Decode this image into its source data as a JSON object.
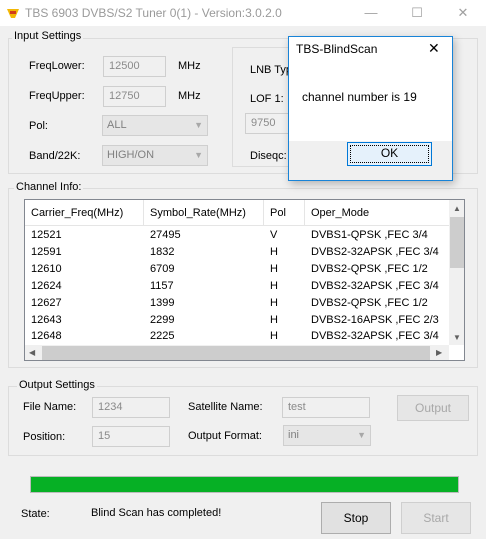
{
  "window": {
    "title": "TBS 6903 DVBS/S2 Tuner 0(1) - Version:3.0.2.0",
    "icon_name": "tbs-app-icon",
    "controls": {
      "minimize": "—",
      "maximize": "☐",
      "close": "✕"
    }
  },
  "input_settings": {
    "group_label": "Input Settings",
    "freq_lower": {
      "label": "FreqLower:",
      "value": "12500",
      "unit": "MHz"
    },
    "freq_upper": {
      "label": "FreqUpper:",
      "value": "12750",
      "unit": "MHz"
    },
    "pol": {
      "label": "Pol:",
      "value": "ALL"
    },
    "band": {
      "label": "Band/22K:",
      "value": "HIGH/ON"
    },
    "lnb_type": {
      "label": "LNB Typ"
    },
    "lof1": {
      "label": "LOF 1:",
      "value": "9750"
    },
    "diseqc": {
      "label": "Diseqc:"
    }
  },
  "channel_info": {
    "group_label": "Channel Info:",
    "columns": [
      "Carrier_Freq(MHz)",
      "Symbol_Rate(MHz)",
      "Pol",
      "Oper_Mode"
    ],
    "rows": [
      [
        "12521",
        "27495",
        "V",
        "DVBS1-QPSK ,FEC 3/4"
      ],
      [
        "12591",
        "1832",
        "H",
        "DVBS2-32APSK ,FEC 3/4"
      ],
      [
        "12610",
        "6709",
        "H",
        "DVBS2-QPSK ,FEC 1/2"
      ],
      [
        "12624",
        "1157",
        "H",
        "DVBS2-32APSK ,FEC 3/4"
      ],
      [
        "12627",
        "1399",
        "H",
        "DVBS2-QPSK ,FEC 1/2"
      ],
      [
        "12643",
        "2299",
        "H",
        "DVBS2-16APSK ,FEC 2/3"
      ],
      [
        "12648",
        "2225",
        "H",
        "DVBS2-32APSK ,FEC 3/4"
      ]
    ]
  },
  "output_settings": {
    "group_label": "Output Settings",
    "file_name": {
      "label": "File Name:",
      "value": "1234"
    },
    "satellite_name": {
      "label": "Satellite Name:",
      "value": "test"
    },
    "position": {
      "label": "Position:",
      "value": "15"
    },
    "output_format": {
      "label": "Output Format:",
      "value": "ini"
    },
    "output_button": "Output"
  },
  "progress": {
    "fraction": 1.0,
    "color": "#06b025"
  },
  "status": {
    "label": "State:",
    "text": "Blind Scan has completed!",
    "stop_button": "Stop",
    "start_button": "Start"
  },
  "dialog": {
    "title": "TBS-BlindScan",
    "message": "channel number is 19",
    "ok_button": "OK",
    "close": "✕",
    "border_color": "#1883d7"
  }
}
